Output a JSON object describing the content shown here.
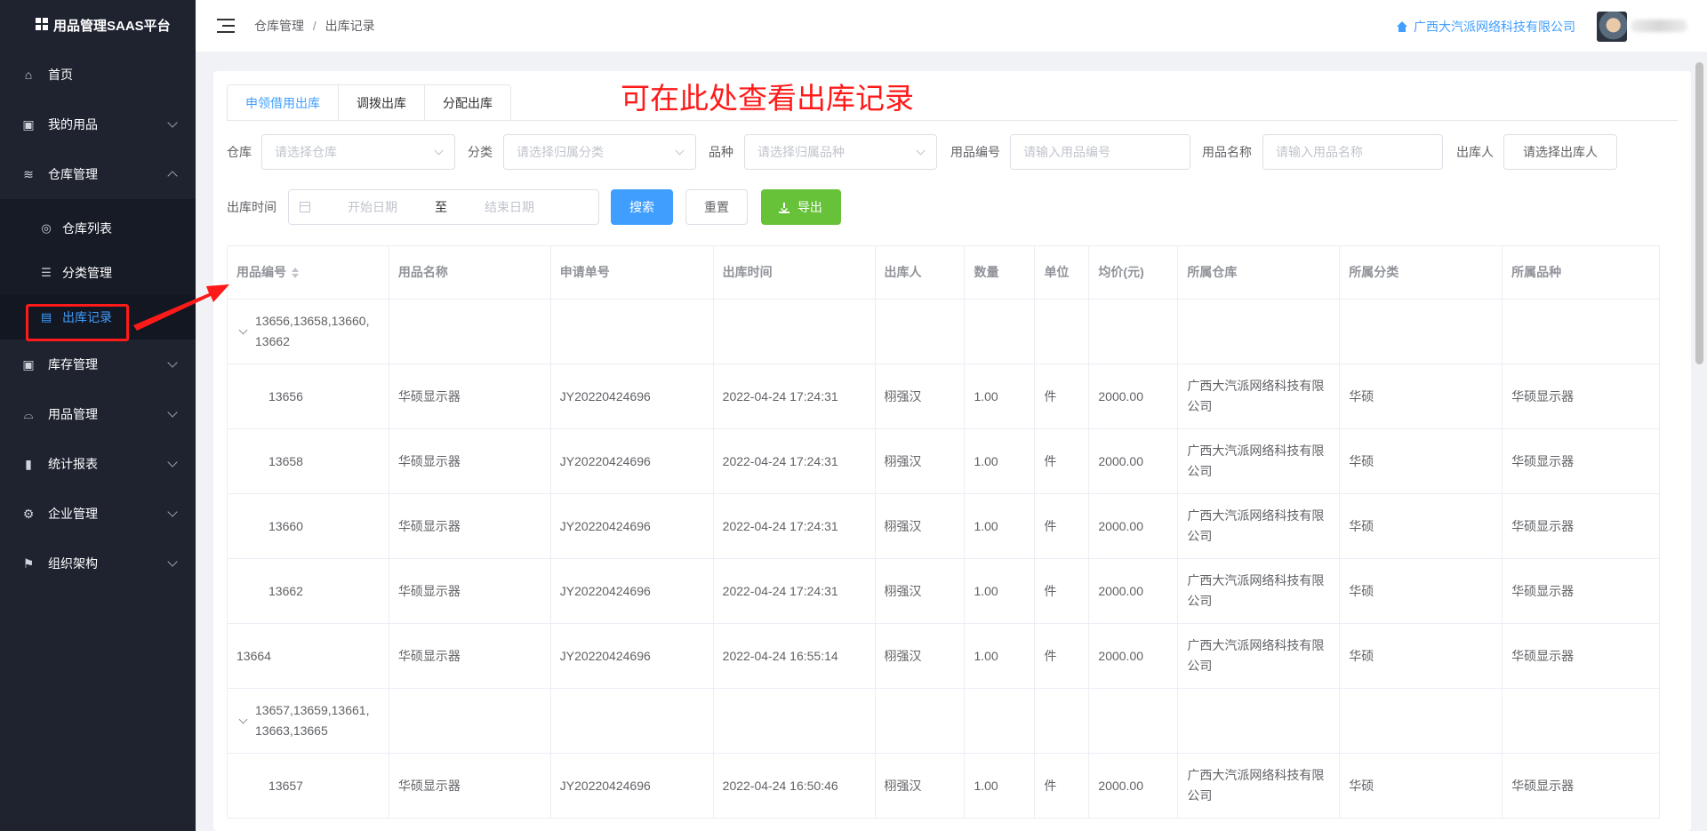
{
  "app": {
    "title": "用品管理SAAS平台",
    "company": "广西大汽派网络科技有限公司",
    "accent_color": "#409eff",
    "sidebar_bg": "#1f2330"
  },
  "sidebar": {
    "items": [
      {
        "label": "首页",
        "icon": "home-icon"
      },
      {
        "label": "我的用品",
        "icon": "bag-icon"
      },
      {
        "label": "仓库管理",
        "icon": "database-icon",
        "expanded": true
      },
      {
        "label": "库存管理",
        "icon": "box-icon"
      },
      {
        "label": "用品管理",
        "icon": "drawer-icon"
      },
      {
        "label": "统计报表",
        "icon": "bar-chart-icon"
      },
      {
        "label": "企业管理",
        "icon": "gear-icon"
      },
      {
        "label": "组织架构",
        "icon": "flag-icon"
      }
    ],
    "submenu": [
      {
        "label": "仓库列表",
        "icon": "location-icon"
      },
      {
        "label": "分类管理",
        "icon": "sliders-icon"
      },
      {
        "label": "出库记录",
        "icon": "document-icon",
        "active": true
      }
    ]
  },
  "breadcrumb": {
    "parent": "仓库管理",
    "separator": "/",
    "current": "出库记录"
  },
  "annotation": "可在此处查看出库记录",
  "tabs": [
    "申领借用出库",
    "调拨出库",
    "分配出库"
  ],
  "filters": {
    "warehouse_label": "仓库",
    "warehouse_placeholder": "请选择仓库",
    "category_label": "分类",
    "category_placeholder": "请选择归属分类",
    "variety_label": "品种",
    "variety_placeholder": "请选择归属品种",
    "code_label": "用品编号",
    "code_placeholder": "请输入用品编号",
    "name_label": "用品名称",
    "name_placeholder": "请输入用品名称",
    "issuer_label": "出库人",
    "issuer_button": "请选择出库人",
    "time_label": "出库时间",
    "date_start": "开始日期",
    "date_separator": "至",
    "date_end": "结束日期",
    "search_button": "搜索",
    "reset_button": "重置",
    "export_button": "导出"
  },
  "table": {
    "columns": [
      "用品编号",
      "用品名称",
      "申请单号",
      "出库时间",
      "出库人",
      "数量",
      "单位",
      "均价(元)",
      "所属仓库",
      "所属分类",
      "所属品种"
    ],
    "rows": [
      {
        "type": "group",
        "code": "13656,13658,13660,\n13662"
      },
      {
        "type": "child",
        "cells": [
          "13656",
          "华硕显示器",
          "JY20220424696",
          "2022-04-24 17:24:31",
          "栩强汉",
          "1.00",
          "件",
          "2000.00",
          "广西大汽派网络科技有限公司",
          "华硕",
          "华硕显示器"
        ]
      },
      {
        "type": "child",
        "cells": [
          "13658",
          "华硕显示器",
          "JY20220424696",
          "2022-04-24 17:24:31",
          "栩强汉",
          "1.00",
          "件",
          "2000.00",
          "广西大汽派网络科技有限公司",
          "华硕",
          "华硕显示器"
        ]
      },
      {
        "type": "child",
        "cells": [
          "13660",
          "华硕显示器",
          "JY20220424696",
          "2022-04-24 17:24:31",
          "栩强汉",
          "1.00",
          "件",
          "2000.00",
          "广西大汽派网络科技有限公司",
          "华硕",
          "华硕显示器"
        ]
      },
      {
        "type": "child",
        "cells": [
          "13662",
          "华硕显示器",
          "JY20220424696",
          "2022-04-24 17:24:31",
          "栩强汉",
          "1.00",
          "件",
          "2000.00",
          "广西大汽派网络科技有限公司",
          "华硕",
          "华硕显示器"
        ]
      },
      {
        "type": "plain",
        "cells": [
          "13664",
          "华硕显示器",
          "JY20220424696",
          "2022-04-24 16:55:14",
          "栩强汉",
          "1.00",
          "件",
          "2000.00",
          "广西大汽派网络科技有限公司",
          "华硕",
          "华硕显示器"
        ]
      },
      {
        "type": "group",
        "code": "13657,13659,13661,\n13663,13665"
      },
      {
        "type": "child",
        "cells": [
          "13657",
          "华硕显示器",
          "JY20220424696",
          "2022-04-24 16:50:46",
          "栩强汉",
          "1.00",
          "件",
          "2000.00",
          "广西大汽派网络科技有限公司",
          "华硕",
          "华硕显示器"
        ]
      }
    ]
  }
}
